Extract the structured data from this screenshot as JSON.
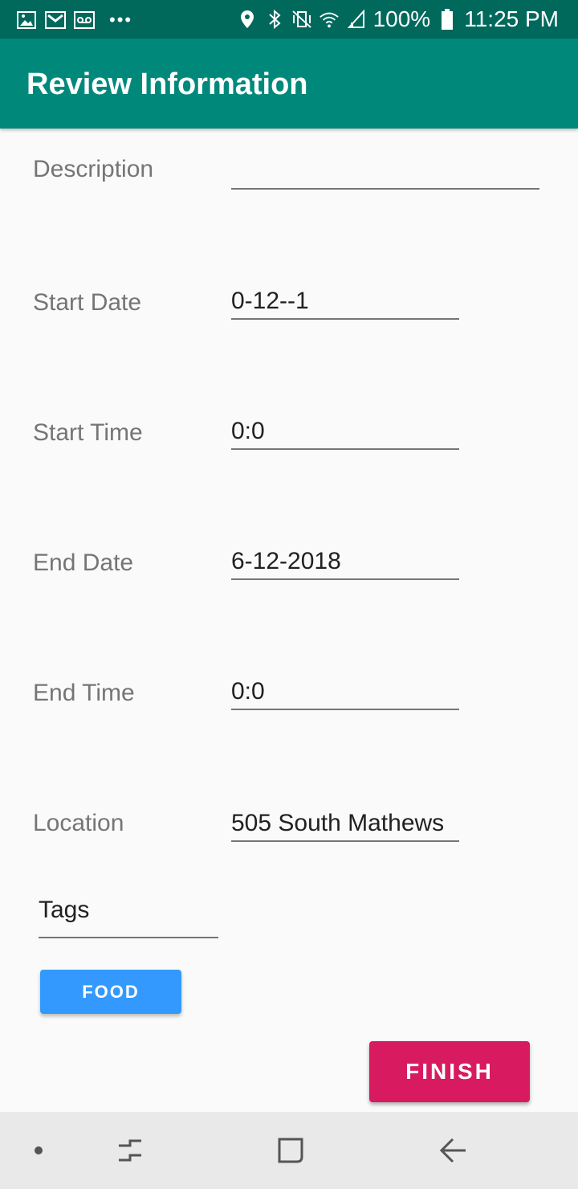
{
  "status_bar": {
    "battery": "100%",
    "time": "11:25 PM",
    "icons_left": [
      "gallery-icon",
      "gmail-icon",
      "voicemail-icon",
      "more-notifications-icon"
    ],
    "icons_right": [
      "location-icon",
      "bluetooth-icon",
      "vibrate-icon",
      "wifi-icon",
      "signal-icon",
      "battery-icon"
    ]
  },
  "app_bar": {
    "title": "Review Information"
  },
  "form": {
    "description": {
      "label": "Description",
      "value": ""
    },
    "start_date": {
      "label": "Start Date",
      "value": "0-12--1"
    },
    "start_time": {
      "label": "Start Time",
      "value": "0:0"
    },
    "end_date": {
      "label": "End Date",
      "value": "6-12-2018"
    },
    "end_time": {
      "label": "End Time",
      "value": "0:0"
    },
    "location": {
      "label": "Location",
      "value": "505 South Mathews"
    }
  },
  "tags": {
    "value": "Tags",
    "chips": [
      "FOOD"
    ]
  },
  "actions": {
    "finish_label": "FINISH"
  },
  "nav_bar": {
    "icons": [
      "nav-dot-icon",
      "recent-apps-icon",
      "home-icon",
      "back-icon"
    ]
  },
  "colors": {
    "status_bar": "#00695c",
    "app_bar": "#00897b",
    "chip": "#3399ff",
    "finish": "#d81b60"
  }
}
